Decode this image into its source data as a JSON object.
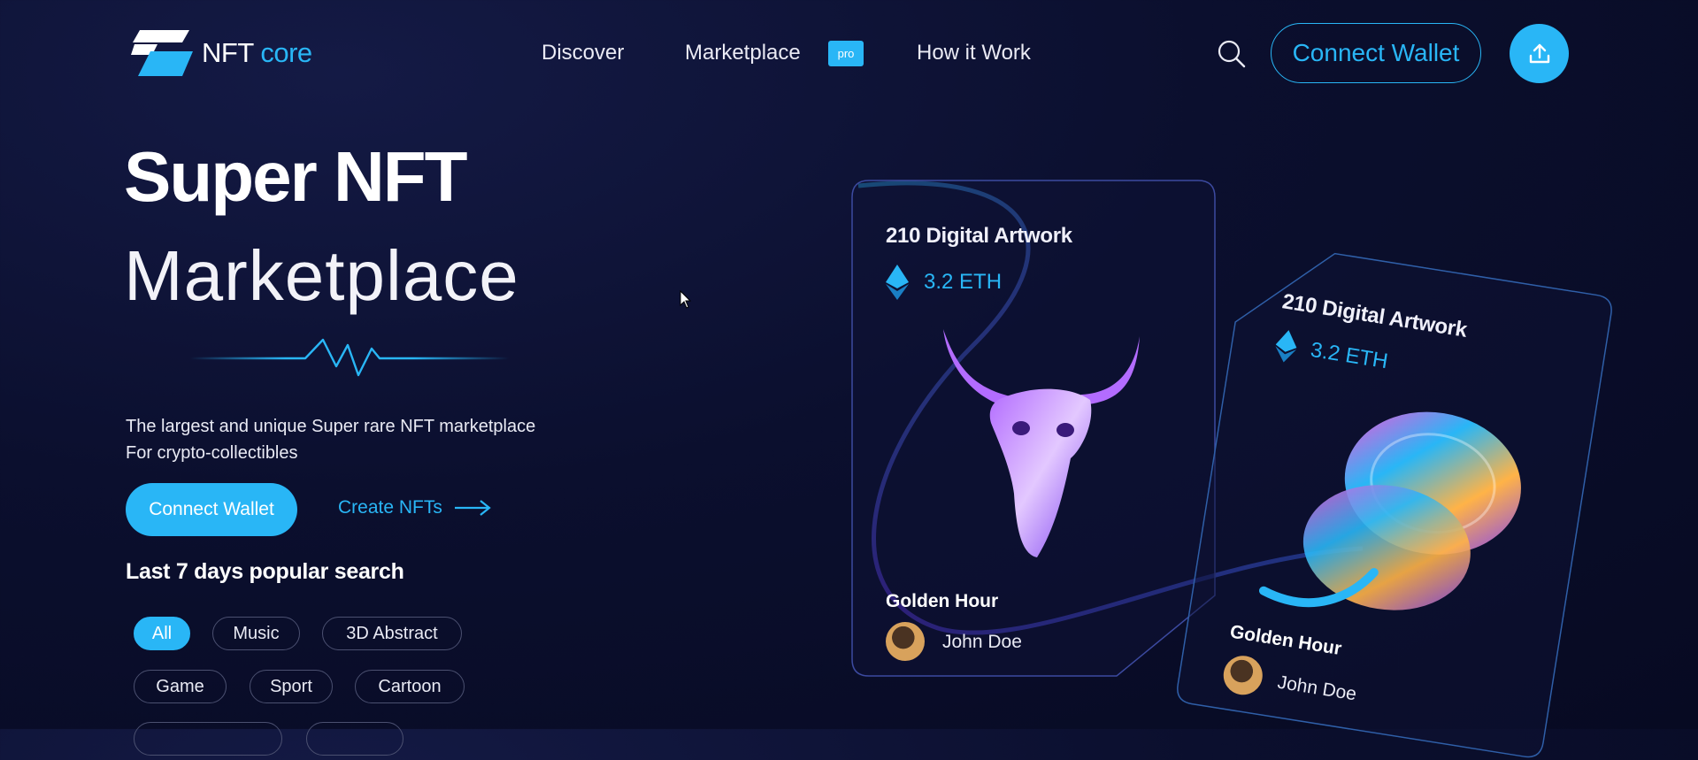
{
  "header": {
    "logo_name": "NFT",
    "logo_accent": "core",
    "nav": [
      {
        "label": "Discover"
      },
      {
        "label": "Marketplace",
        "badge": "pro"
      },
      {
        "label": "How it Work"
      }
    ],
    "connect_label": "Connect Wallet"
  },
  "hero": {
    "title_bold": "Super NFT",
    "title_thin": "Marketplace",
    "desc_line1": "The largest and unique Super rare NFT marketplace",
    "desc_line2": "For crypto-collectibles",
    "cta_label": "Connect Wallet",
    "create_label": "Create NFTs",
    "popular_title": "Last 7 days popular search",
    "chips": [
      "All",
      "Music",
      "3D Abstract",
      "Game",
      "Sport",
      "Cartoon"
    ]
  },
  "cards": [
    {
      "title": "210 Digital Artwork",
      "price": "3.2 ETH",
      "name": "Golden Hour",
      "owner": "John Doe"
    },
    {
      "title": "210 Digital Artwork",
      "price": "3.2 ETH",
      "name": "Golden Hour",
      "owner": "John Doe"
    }
  ],
  "colors": {
    "accent": "#29b6f6",
    "background": "#0b0f2e"
  }
}
